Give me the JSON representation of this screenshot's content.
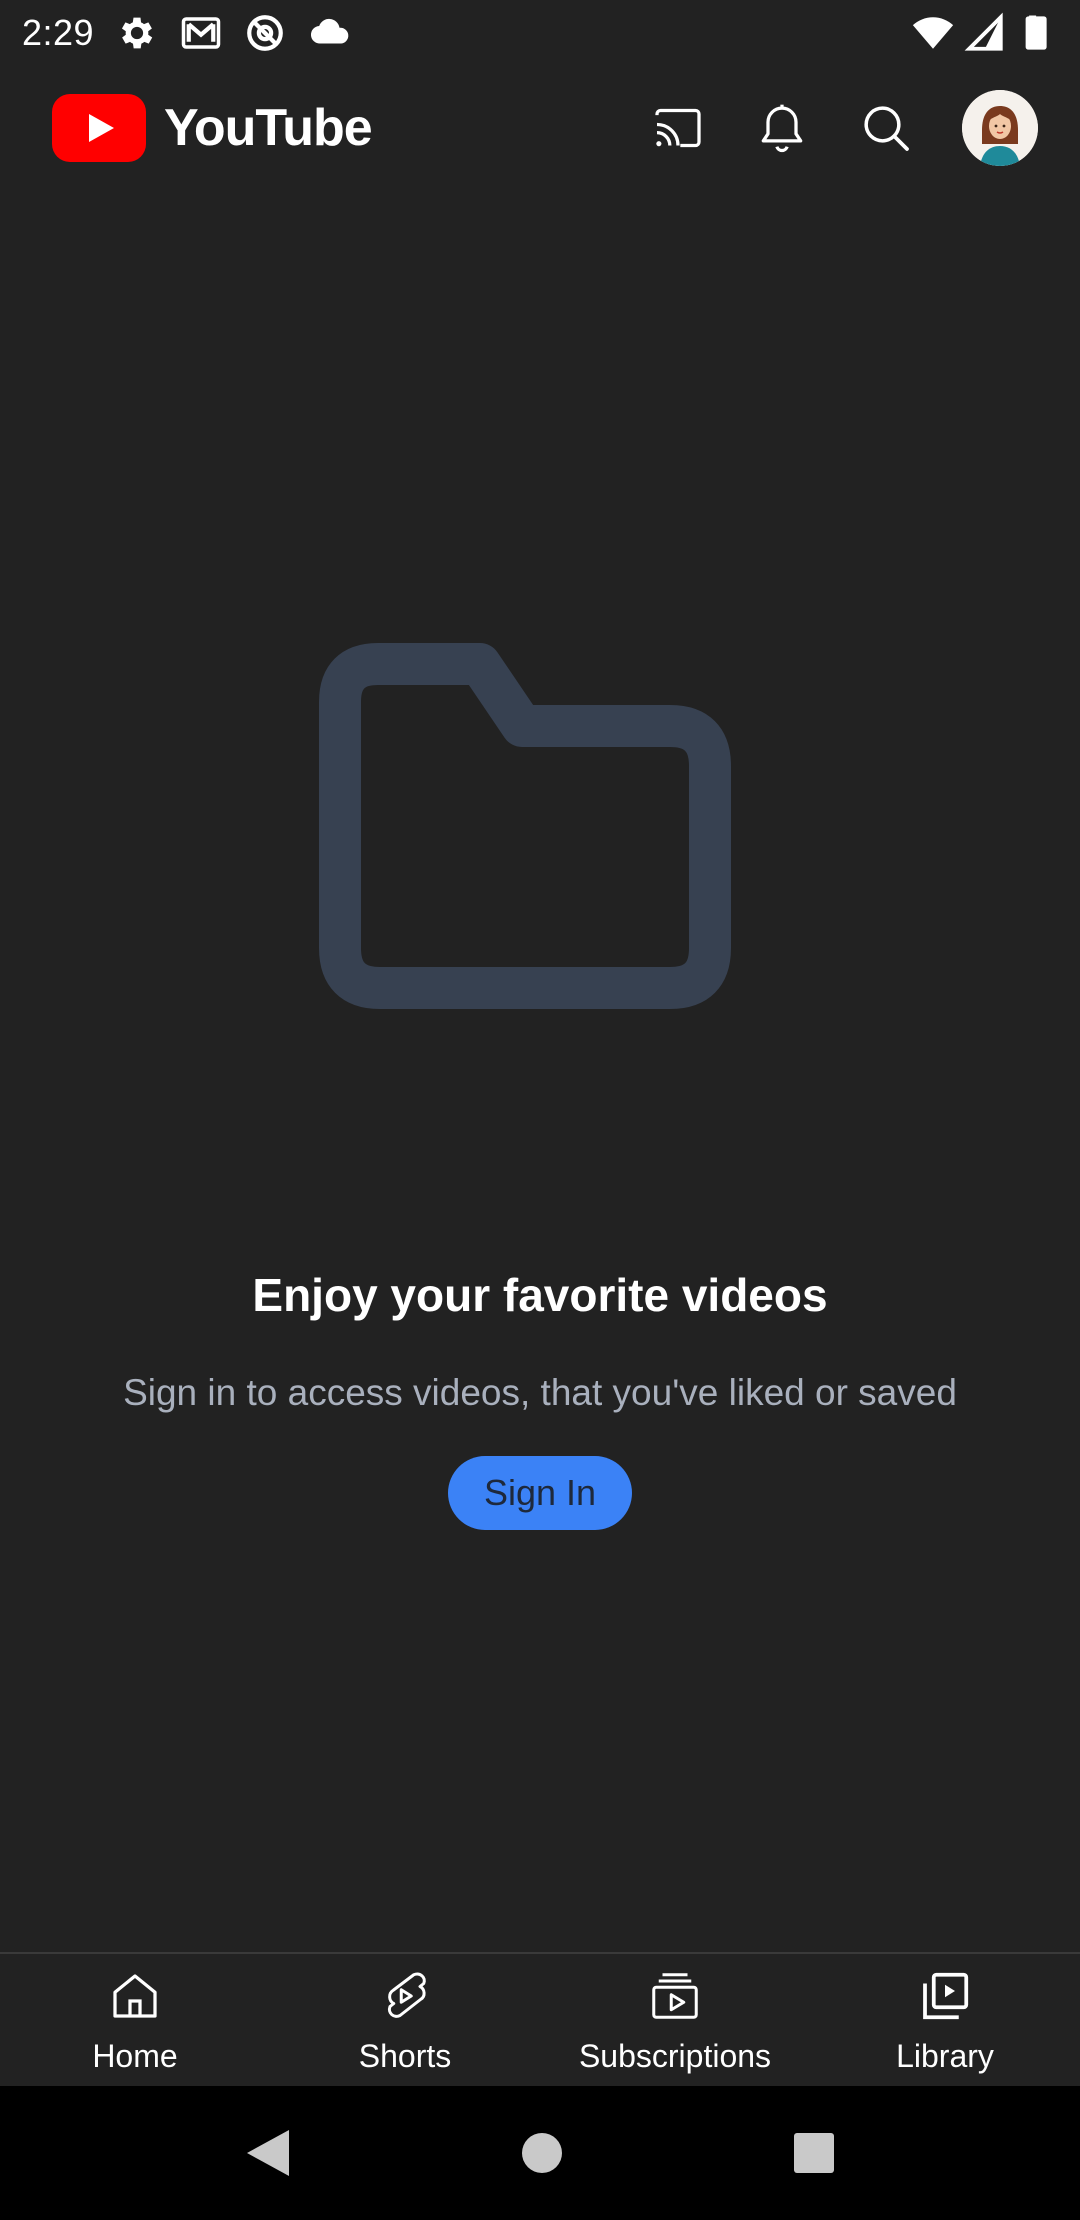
{
  "status_bar": {
    "time": "2:29",
    "left_icons": [
      "gear-icon",
      "gmail-icon",
      "at-sign-icon",
      "cloud-icon"
    ],
    "right_icons": [
      "wifi-icon",
      "signal-icon",
      "battery-icon"
    ]
  },
  "app_bar": {
    "brand_name": "YouTube",
    "brand_color": "#ff0000",
    "actions": [
      "cast-icon",
      "notifications-bell-icon",
      "search-icon",
      "account-avatar"
    ]
  },
  "empty_state": {
    "illustration": "folder-icon",
    "illustration_color": "#374151",
    "title": "Enjoy your favorite videos",
    "subtitle": "Sign in to access videos, that you've liked or saved",
    "button_label": "Sign In",
    "button_color": "#3b82f6"
  },
  "bottom_nav": {
    "items": [
      {
        "label": "Home",
        "icon": "home-icon"
      },
      {
        "label": "Shorts",
        "icon": "shorts-icon"
      },
      {
        "label": "Subscriptions",
        "icon": "subscriptions-icon"
      },
      {
        "label": "Library",
        "icon": "library-icon"
      }
    ]
  },
  "system_nav": {
    "buttons": [
      "back-button",
      "home-button",
      "recents-button"
    ]
  }
}
